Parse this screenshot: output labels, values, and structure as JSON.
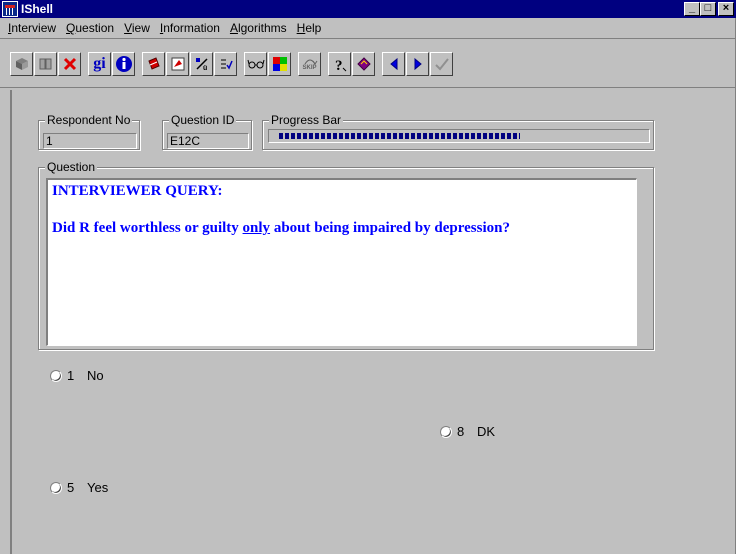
{
  "window": {
    "title": "IShell",
    "controls": {
      "minimize": "_",
      "maximize": "□",
      "close": "×"
    }
  },
  "menu": [
    {
      "label": "Interview",
      "key": "I"
    },
    {
      "label": "Question",
      "key": "Q"
    },
    {
      "label": "View",
      "key": "V"
    },
    {
      "label": "Information",
      "key": "I"
    },
    {
      "label": "Algorithms",
      "key": "A"
    },
    {
      "label": "Help",
      "key": "H"
    }
  ],
  "toolbar": {
    "icons": [
      "book-icon",
      "library-icon",
      "delete-icon",
      "gi-icon",
      "info-icon",
      "notebook-icon",
      "red-flag-icon",
      "variable-icon",
      "checklist-icon",
      "glasses-icon",
      "color-grid-icon",
      "skip-icon",
      "help-icon",
      "book-purple-icon",
      "previous-icon",
      "next-icon",
      "check-icon"
    ],
    "gi_label": "gi",
    "skip_label": "SKIP"
  },
  "fields": {
    "respondent_label": "Respondent No",
    "respondent_value": "1",
    "question_id_label": "Question ID",
    "question_id_value": "E12C",
    "progress_label": "Progress Bar",
    "progress_fraction": 0.67
  },
  "question": {
    "label": "Question",
    "title": "INTERVIEWER QUERY:",
    "text_before": "Did R feel worthless or guilty ",
    "text_underlined": "only",
    "text_after": " about being impaired by depression?"
  },
  "options": [
    {
      "code": "1",
      "label": "No",
      "selected": false
    },
    {
      "code": "8",
      "label": "DK",
      "selected": false
    },
    {
      "code": "5",
      "label": "Yes",
      "selected": false
    }
  ],
  "colors": {
    "title_bar": "#000080",
    "window_bg": "#c0c0c0",
    "question_text": "#0000ff"
  }
}
